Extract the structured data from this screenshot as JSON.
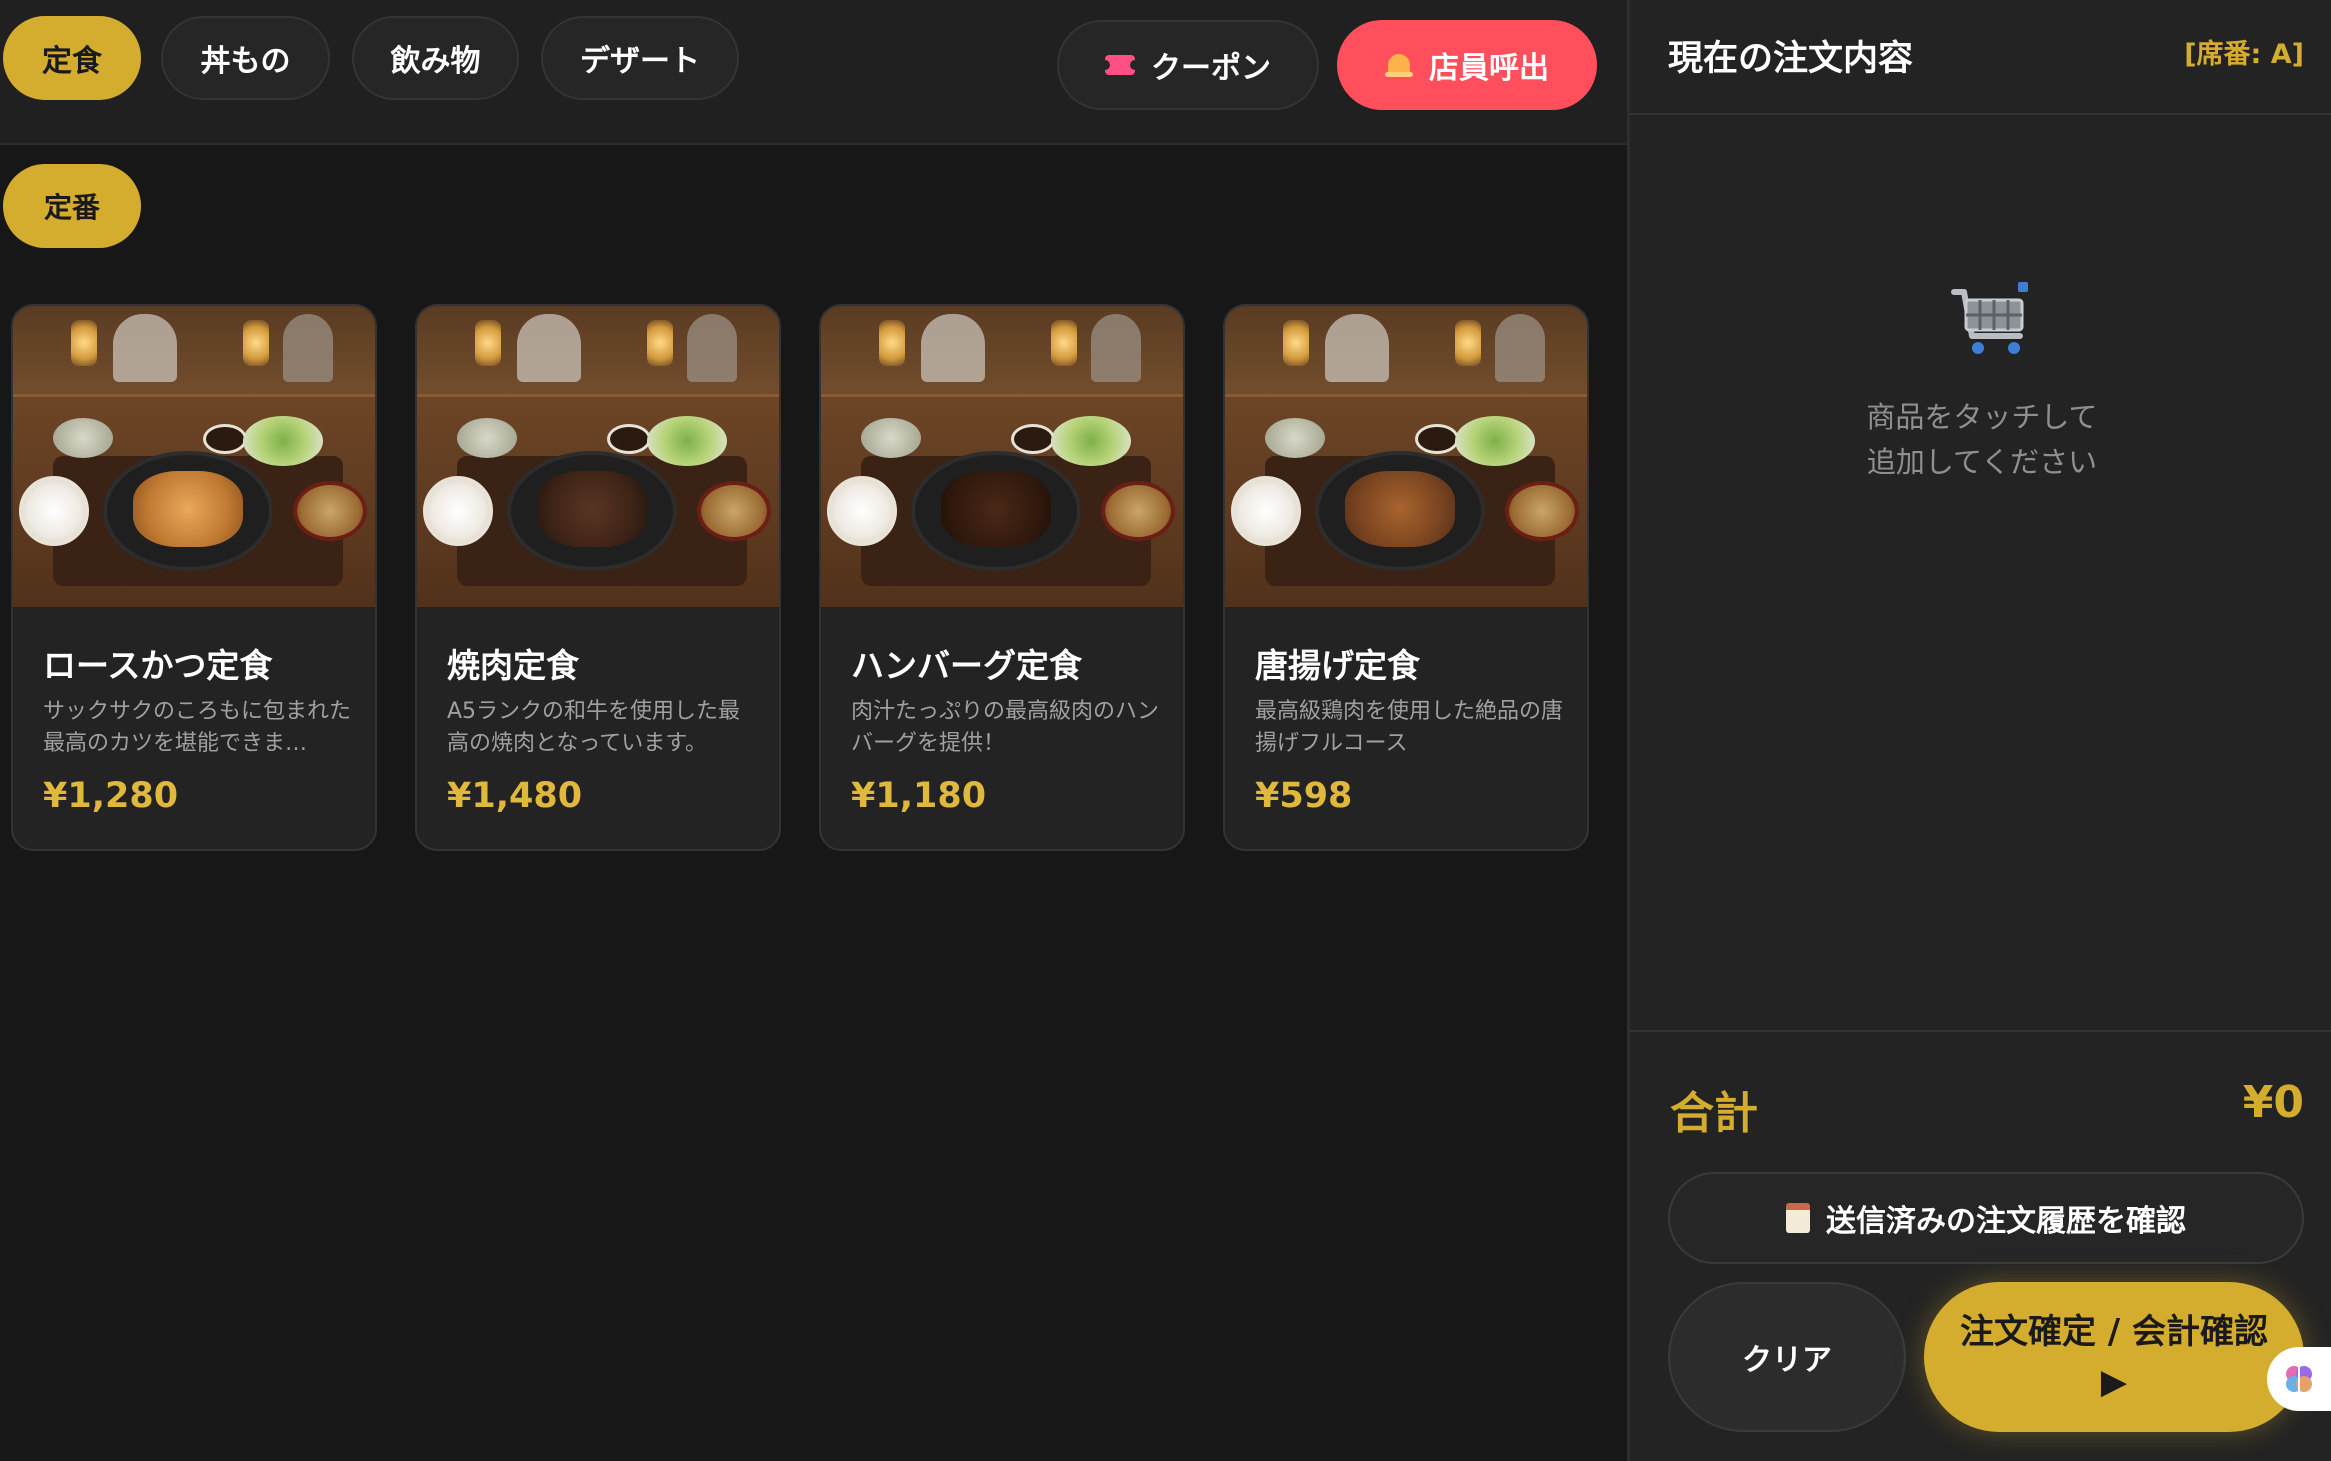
{
  "categories": [
    {
      "label": "定食",
      "active": true
    },
    {
      "label": "丼もの",
      "active": false
    },
    {
      "label": "飲み物",
      "active": false
    },
    {
      "label": "デザート",
      "active": false
    }
  ],
  "header_buttons": {
    "coupon_label": "クーポン",
    "coupon_icon": "ticket-icon",
    "call_label": "店員呼出",
    "call_icon": "bell-icon"
  },
  "subcategory": {
    "label": "定番"
  },
  "menu_items": [
    {
      "name": "ロースかつ定食",
      "description": "サックサクのころもに包まれた最高のカツを堪能できま…",
      "price": "¥1,280"
    },
    {
      "name": "焼肉定食",
      "description": "A5ランクの和牛を使用した最高の焼肉となっています。",
      "price": "¥1,480"
    },
    {
      "name": "ハンバーグ定食",
      "description": "肉汁たっぷりの最高級肉のハンバーグを提供！",
      "price": "¥1,180"
    },
    {
      "name": "唐揚げ定食",
      "description": "最高級鶏肉を使用した絶品の唐揚げフルコース",
      "price": "¥598"
    }
  ],
  "order": {
    "title": "現在の注文内容",
    "seat": "[席番: A]",
    "empty_line1": "商品をタッチして",
    "empty_line2": "追加してください",
    "total_label": "合計",
    "total_value": "¥0",
    "history_label": "送信済みの注文履歴を確認",
    "clear_label": "クリア",
    "confirm_label": "注文確定 / 会計確認 ▶"
  },
  "colors": {
    "accent": "#d4ad2f",
    "call": "#ff4f5c",
    "background": "#171717",
    "panel": "#232323"
  }
}
